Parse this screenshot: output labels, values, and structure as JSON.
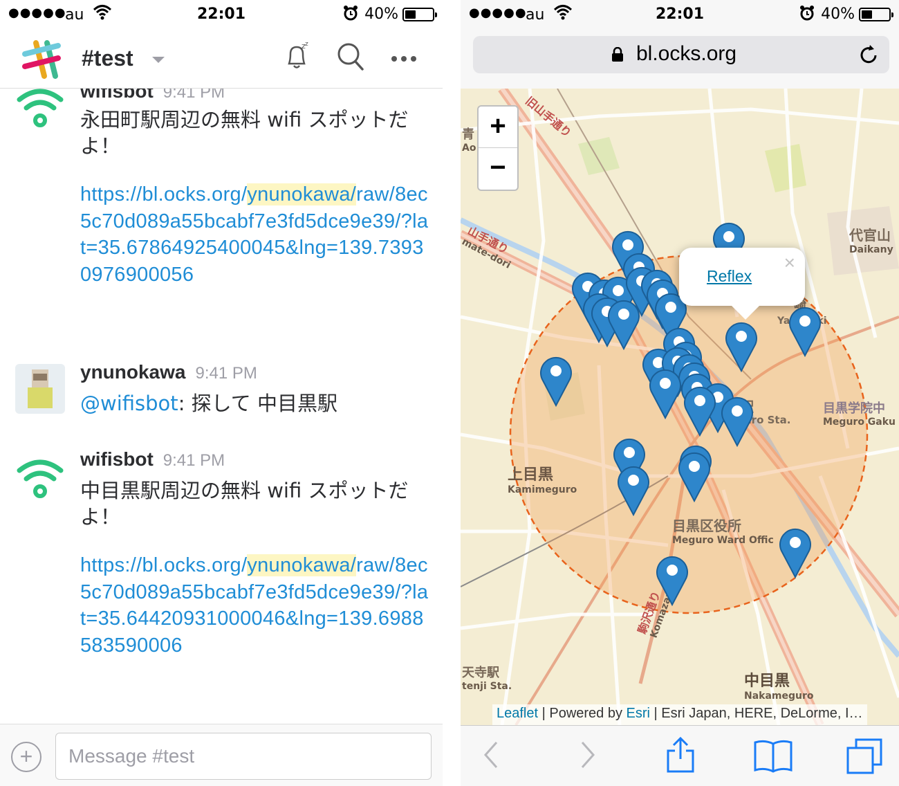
{
  "status": {
    "signal": "●●●●●",
    "carrier": "au",
    "time": "22:01",
    "battery": "40%"
  },
  "slack": {
    "channel": "#test",
    "messages": [
      {
        "sender": "wifisbot",
        "time": "9:41 PM",
        "text": "永田町駅周辺の無料 wifi スポットだよ！",
        "link_pre": "https://bl.ocks.org/",
        "link_hl": "ynunokawa/",
        "link_post": "raw/8ec5c70d089a55bcabf7e3fd5dce9e39/?lat=35.67864925400045&lng=139.73930976900056"
      },
      {
        "sender": "ynunokawa",
        "time": "9:41 PM",
        "mention": "@wifisbot",
        "text": ": 探して 中目黒駅"
      },
      {
        "sender": "wifisbot",
        "time": "9:41 PM",
        "text": "中目黒駅周辺の無料 wifi スポットだよ！",
        "link_pre": "https://bl.ocks.org/",
        "link_hl": "ynunokawa/",
        "link_post": "raw/8ec5c70d089a55bcabf7e3fd5dce9e39/?lat=35.64420931000046&lng=139.6988583590006"
      }
    ],
    "composer_placeholder": "Message #test"
  },
  "safari": {
    "url": "bl.ocks.org",
    "zoom_in": "+",
    "zoom_out": "−",
    "popup_link": "Reflex",
    "popup_close": "×",
    "attribution": {
      "leaflet": "Leaflet",
      "powered": " | Powered by ",
      "esri": "Esri",
      "sources": " | Esri Japan, HERE, DeLorme, I…"
    },
    "map_labels": {
      "kamimeguro_jp": "上目黒",
      "kamimeguro_en": "Kamimeguro",
      "ward_jp": "目黒区役所",
      "ward_en": "Meguro Ward Offic",
      "naka_jp": "中目黒",
      "naka_en": "Nakameguro",
      "daikan_jp": "代官山",
      "daikan_en": "Daikany",
      "gakuin_jp": "目黒学院中",
      "gakuin_en": "Meguro Gaku",
      "yamanote_jp": "山手通り",
      "yamanote_en": "mate-dori",
      "kyu_yamate": "旧山手通り",
      "komazawa_jp": "駒沢通り",
      "komazawa_en": "Komazawa",
      "tenji_jp": "天寺駅",
      "tenji_en": "tenji Sta.",
      "sta_en": "uro Sta.",
      "eki_jp": "駅",
      "ao_jp": "青",
      "ao_en": "Ao",
      "ya_jp": "崎",
      "ya_en": "Ya",
      "ya_en2": "aki"
    }
  }
}
